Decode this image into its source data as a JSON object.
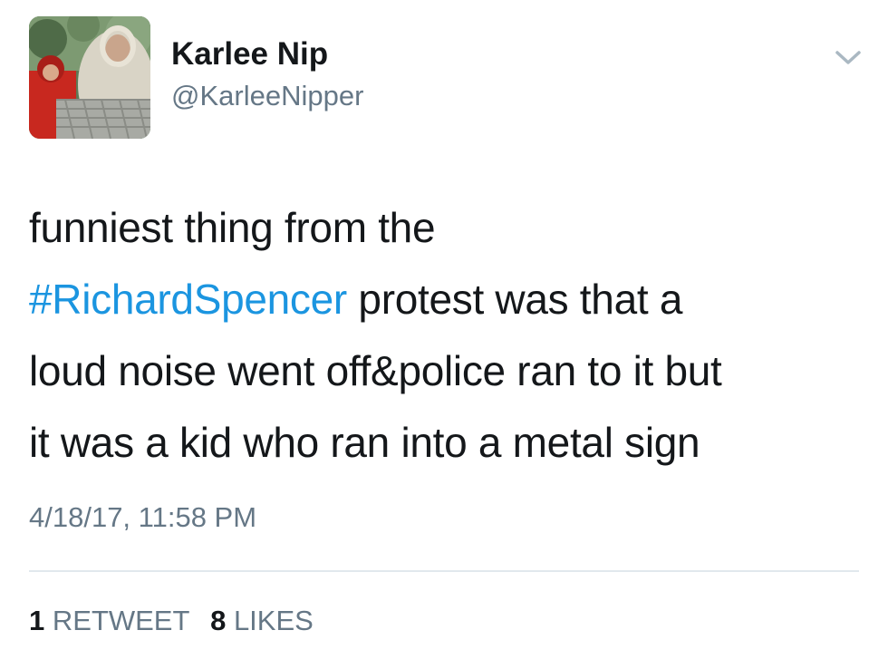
{
  "user": {
    "display_name": "Karlee Nip",
    "handle": "@KarleeNipper"
  },
  "tweet": {
    "lines": [
      [
        {
          "text": "funniest thing from the",
          "type": "text"
        }
      ],
      [
        {
          "text": "#RichardSpencer",
          "type": "hashtag"
        },
        {
          "text": " protest was that a",
          "type": "text"
        }
      ],
      [
        {
          "text": "loud noise went off&police ran to it but",
          "type": "text"
        }
      ],
      [
        {
          "text": "it was a kid who ran into a metal sign",
          "type": "text"
        }
      ]
    ],
    "timestamp": "4/18/17, 11:58 PM"
  },
  "stats": {
    "retweets_count": "1",
    "retweets_label": "RETWEET",
    "likes_count": "8",
    "likes_label": "LIKES"
  },
  "colors": {
    "hashtag": "#1b95e0",
    "secondary_text": "#657786",
    "primary_text": "#14171a",
    "divider": "#e1e8ed"
  },
  "icons": {
    "menu": "chevron-down-icon"
  }
}
